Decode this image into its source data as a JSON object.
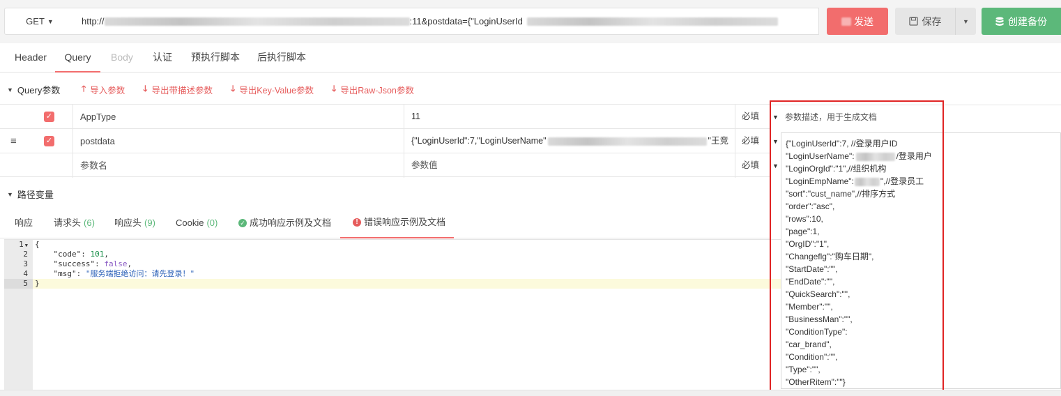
{
  "request": {
    "method": "GET",
    "url_visible_part": ":11&postdata={\"LoginUserId",
    "url_prefix": "http://",
    "send_label": "发送",
    "save_label": "保存",
    "backup_label": "创建备份"
  },
  "request_tabs": [
    {
      "label": "Header"
    },
    {
      "label": "Query"
    },
    {
      "label": "Body"
    },
    {
      "label": "认证"
    },
    {
      "label": "预执行脚本"
    },
    {
      "label": "后执行脚本"
    }
  ],
  "query": {
    "section_title": "Query参数",
    "actions": {
      "import": "导入参数",
      "export_desc": "导出带描述参数",
      "export_kv": "导出Key-Value参数",
      "export_raw": "导出Raw-Json参数"
    },
    "rows": [
      {
        "name": "AppType",
        "value": "11",
        "required": "必填"
      },
      {
        "name": "postdata",
        "value": "{\"LoginUserId\":7,\"LoginUserName\"",
        "value_tail": "\"王竞",
        "required": "必填"
      }
    ],
    "placeholder_row": {
      "name": "参数名",
      "value": "参数值",
      "required": "必填"
    },
    "desc_header": "参数描述，用于生成文档",
    "desc_lines": [
      "{\"LoginUserId\":7, //登录用户ID",
      "\"LoginUserName\":",
      "\"LoginOrgId\":\"1\",//组织机构",
      "\"LoginEmpName\":",
      "\"sort\":\"cust_name\",//排序方式",
      "\"order\":\"asc\",",
      "\"rows\":10,",
      "\"page\":1,",
      "\"OrgID\":\"1\",",
      "\"Changeflg\":\"购车日期\",",
      "\"StartDate\":\"\",",
      "\"EndDate\":\"\",",
      "\"QuickSearch\":\"\",",
      "\"Member\":\"\",",
      "\"BusinessMan\":\"\",",
      "\"ConditionType\":",
      "\"car_brand\",",
      "\"Condition\":\"\",",
      "\"Type\":\"\",",
      "\"OtherRitem\":\"\"}"
    ],
    "desc_line2_tail": "/登录用户",
    "desc_line4_tail": "\",//登录员工"
  },
  "path_vars": {
    "section_title": "路径变量"
  },
  "response_tabs": [
    {
      "label": "响应"
    },
    {
      "label": "请求头",
      "count": "(6)"
    },
    {
      "label": "响应头",
      "count": "(9)"
    },
    {
      "label": "Cookie",
      "count": "(0)"
    },
    {
      "label": "成功响应示例及文档"
    },
    {
      "label": "错误响应示例及文档"
    }
  ],
  "editor": {
    "line_numbers": [
      "1",
      "2",
      "3",
      "4",
      "5"
    ],
    "line1": "{",
    "code_key": "\"code\"",
    "code_val": "101",
    "success_key": "\"success\"",
    "success_val": "false",
    "msg_key": "\"msg\"",
    "msg_val": "\"服务端拒绝访问：请先登录！\"",
    "line5": "}"
  },
  "colors": {
    "accent_red": "#f26d6d",
    "green": "#5cb87a",
    "highlight_frame": "#e02424"
  }
}
